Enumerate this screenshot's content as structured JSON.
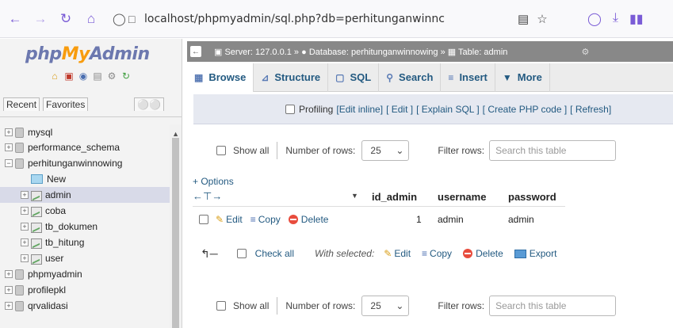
{
  "browser": {
    "url_main": "localhost/phpmyadmin/sql.php?db=perhitunganwinnc",
    "icons": [
      "back-icon",
      "forward-icon",
      "reload-icon",
      "home-icon",
      "shield-icon",
      "page-icon",
      "reader-icon",
      "star-icon",
      "pocket-icon",
      "download-icon",
      "library-icon"
    ]
  },
  "sidebar": {
    "logo": {
      "php": "php",
      "my": "My",
      "admin": "Admin"
    },
    "tabs": {
      "recent": "Recent",
      "favorites": "Favorites"
    },
    "tree": [
      {
        "label": "mysql",
        "type": "db",
        "indent": 0
      },
      {
        "label": "performance_schema",
        "type": "db",
        "indent": 0
      },
      {
        "label": "perhitunganwinnowing",
        "type": "db",
        "indent": 0,
        "expanded": true
      },
      {
        "label": "New",
        "type": "new",
        "indent": 1
      },
      {
        "label": "admin",
        "type": "table",
        "indent": 1,
        "active": true
      },
      {
        "label": "coba",
        "type": "table",
        "indent": 1
      },
      {
        "label": "tb_dokumen",
        "type": "table",
        "indent": 1
      },
      {
        "label": "tb_hitung",
        "type": "table",
        "indent": 1
      },
      {
        "label": "user",
        "type": "table",
        "indent": 1
      },
      {
        "label": "phpmyadmin",
        "type": "db",
        "indent": 0
      },
      {
        "label": "profilepkl",
        "type": "db",
        "indent": 0
      },
      {
        "label": "qrvalidasi",
        "type": "db",
        "indent": 0
      }
    ]
  },
  "breadcrumb": {
    "server": "Server: 127.0.0.1",
    "database": "Database: perhitunganwinnowing",
    "table": "Table: admin",
    "sep": "»"
  },
  "menu": [
    {
      "label": "Browse",
      "icon": "browse-icon",
      "active": true
    },
    {
      "label": "Structure",
      "icon": "structure-icon"
    },
    {
      "label": "SQL",
      "icon": "sql-icon"
    },
    {
      "label": "Search",
      "icon": "search-icon"
    },
    {
      "label": "Insert",
      "icon": "insert-icon"
    },
    {
      "label": "More",
      "icon": "chevron-down-icon"
    }
  ],
  "profiling": {
    "label": "Profiling",
    "links": [
      "[Edit inline]",
      "[ Edit ]",
      "[ Explain SQL ]",
      "[ Create PHP code ]",
      "[ Refresh]"
    ]
  },
  "nav": {
    "show_all": "Show all",
    "rows_label": "Number of rows:",
    "rows_value": "25",
    "filter_label": "Filter rows:",
    "filter_placeholder": "Search this table"
  },
  "options_link": "+ Options",
  "columns": [
    "id_admin",
    "username",
    "password"
  ],
  "rows": [
    {
      "id_admin": "1",
      "username": "admin",
      "password": "admin"
    }
  ],
  "row_actions": {
    "edit": "Edit",
    "copy": "Copy",
    "delete": "Delete"
  },
  "bulk": {
    "check_all": "Check all",
    "with_selected": "With selected:",
    "edit": "Edit",
    "copy": "Copy",
    "delete": "Delete",
    "export": "Export"
  }
}
